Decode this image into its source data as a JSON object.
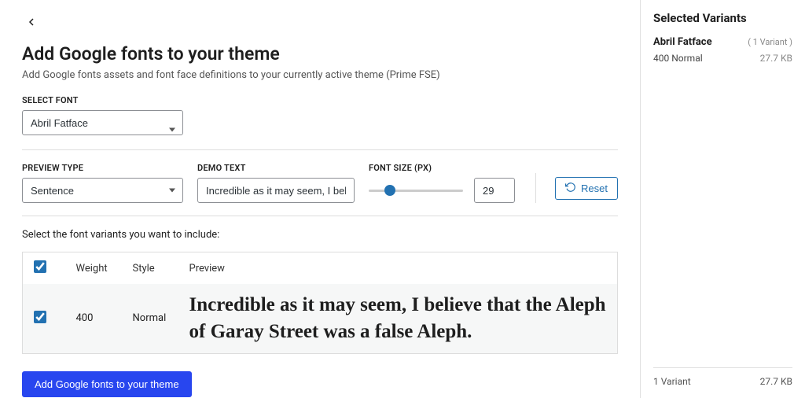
{
  "page": {
    "title": "Add Google fonts to your theme",
    "subtitle": "Add Google fonts assets and font face definitions to your currently active theme (Prime FSE)"
  },
  "select_font": {
    "label": "Select Font",
    "value": "Abril Fatface"
  },
  "preview_type": {
    "label": "Preview Type",
    "value": "Sentence"
  },
  "demo_text": {
    "label": "Demo Text",
    "value": "Incredible as it may seem, I believe that the Aleph of Garay Street was a false Aleph."
  },
  "font_size": {
    "label": "Font Size (px)",
    "value": "29"
  },
  "reset_label": "Reset",
  "variants_instruction": "Select the font variants you want to include:",
  "table": {
    "headers": {
      "weight": "Weight",
      "style": "Style",
      "preview": "Preview"
    },
    "rows": [
      {
        "weight": "400",
        "style": "Normal",
        "preview": "Incredible as it may seem, I believe that the Aleph of Garay Street was a false Aleph."
      }
    ]
  },
  "primary_button": "Add Google fonts to your theme",
  "sidebar": {
    "title": "Selected Variants",
    "fonts": [
      {
        "name": "Abril Fatface",
        "count": "( 1 Variant )",
        "variants": [
          {
            "label": "400 Normal",
            "size": "27.7 KB"
          }
        ]
      }
    ],
    "footer": {
      "count": "1 Variant",
      "size": "27.7 KB"
    }
  }
}
